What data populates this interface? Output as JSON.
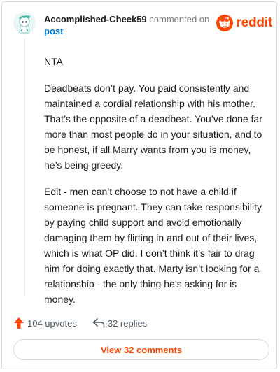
{
  "comment": {
    "username": "Accomplished-Cheek59",
    "commented_on": "commented on",
    "post_link": "post",
    "paragraphs": [
      "NTA",
      "Deadbeats don’t pay. You paid consistently and maintained a cordial relationship with his mother. That’s the opposite of a deadbeat. You’ve done far more than most people do in your situation, and to be honest, if all Marry wants from you is money, he’s being greedy.",
      "Edit - men can’t choose to not have a child if someone is pregnant. They can take responsibility by paying child support and avoid emotionally damaging them by flirting in and out of their lives, which is what OP did. I don’t think it’s fair to drag him for doing exactly that. Marty isn’t looking for a relationship - the only thing he’s asking for is money."
    ]
  },
  "brand": {
    "wordmark": "reddit",
    "color": "#ff4500"
  },
  "actions": {
    "upvotes": "104 upvotes",
    "replies": "32 replies"
  },
  "footer": {
    "view_comments": "View 32 comments"
  },
  "icons": {
    "upvote": "upvote-arrow-icon",
    "reply": "reply-arrow-icon",
    "logo": "reddit-alien-icon",
    "avatar": "snoo-avatar-icon"
  }
}
